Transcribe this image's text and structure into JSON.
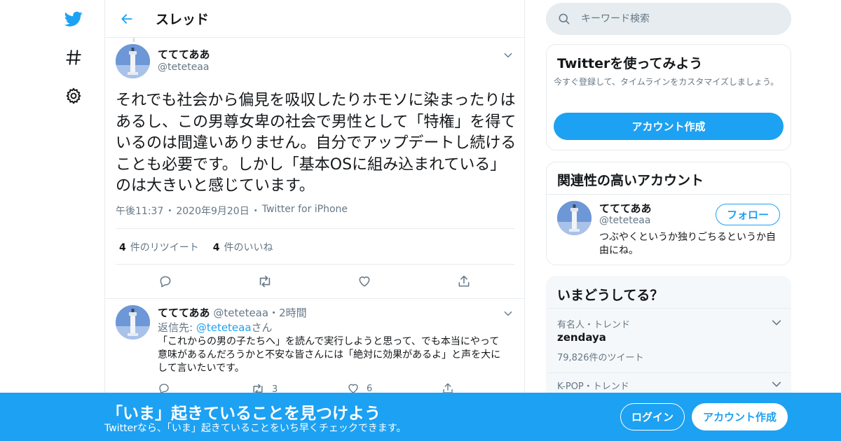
{
  "colors": {
    "accent": "#1da1f2",
    "text": "#14171a",
    "secondary": "#657786",
    "border": "#e6ecf0"
  },
  "nav": {
    "icons": [
      "twitter-logo-icon",
      "hashtag-icon",
      "gear-icon"
    ]
  },
  "header": {
    "title": "スレッド"
  },
  "tweet": {
    "name": "てててああ",
    "handle": "@teteteaa",
    "text": "それでも社会から偏見を吸収したりホモソに染まったりはあるし、この男尊女卑の社会で男性として「特権」を得ているのは間違いありません。自分でアップデートし続けることも必要です。しかし「基本OSに組み込まれている」のは大きいと感じています。",
    "time": "午後11:37",
    "date": "2020年9月20日",
    "sep": "・",
    "source": "Twitter for iPhone",
    "retweet_count": "4",
    "retweet_label": "件のリツイート",
    "like_count": "4",
    "like_label": "件のいいね"
  },
  "reply": {
    "name": "てててああ",
    "handle": "@teteteaa",
    "sep": "・",
    "age": "2時間",
    "reply_prefix": "返信先: ",
    "reply_handle": "@teteteaa",
    "reply_suffix": "さん",
    "text": "「これからの男の子たちへ」を読んで実行しようと思って、でも本当にやって意味があるんだろうかと不安な皆さんには「絶対に効果があるよ」と声を大にして言いたいです。",
    "retweets": "3",
    "likes": "6"
  },
  "search": {
    "placeholder": "キーワード検索"
  },
  "signup_card": {
    "title": "Twitterを使ってみよう",
    "desc": "今すぐ登録して、タイムラインをカスタマイズしましょう。",
    "button": "アカウント作成"
  },
  "related": {
    "title": "関連性の高いアカウント",
    "name": "てててああ",
    "handle": "@teteteaa",
    "follow": "フォロー",
    "bio": "つぶやくというか独りごちるというか自由にね。"
  },
  "trends": {
    "title": "いまどうしてる？",
    "items": [
      {
        "category": "有名人・トレンド",
        "name": "zendaya",
        "count": "79,826件のツイート"
      },
      {
        "category": "K-POP・トレンド"
      }
    ]
  },
  "banner": {
    "title": "「いま」起きていることを見つけよう",
    "sub": "Twitterなら、「いま」起きていることをいち早くチェックできます。",
    "login": "ログイン",
    "signup": "アカウント作成"
  }
}
